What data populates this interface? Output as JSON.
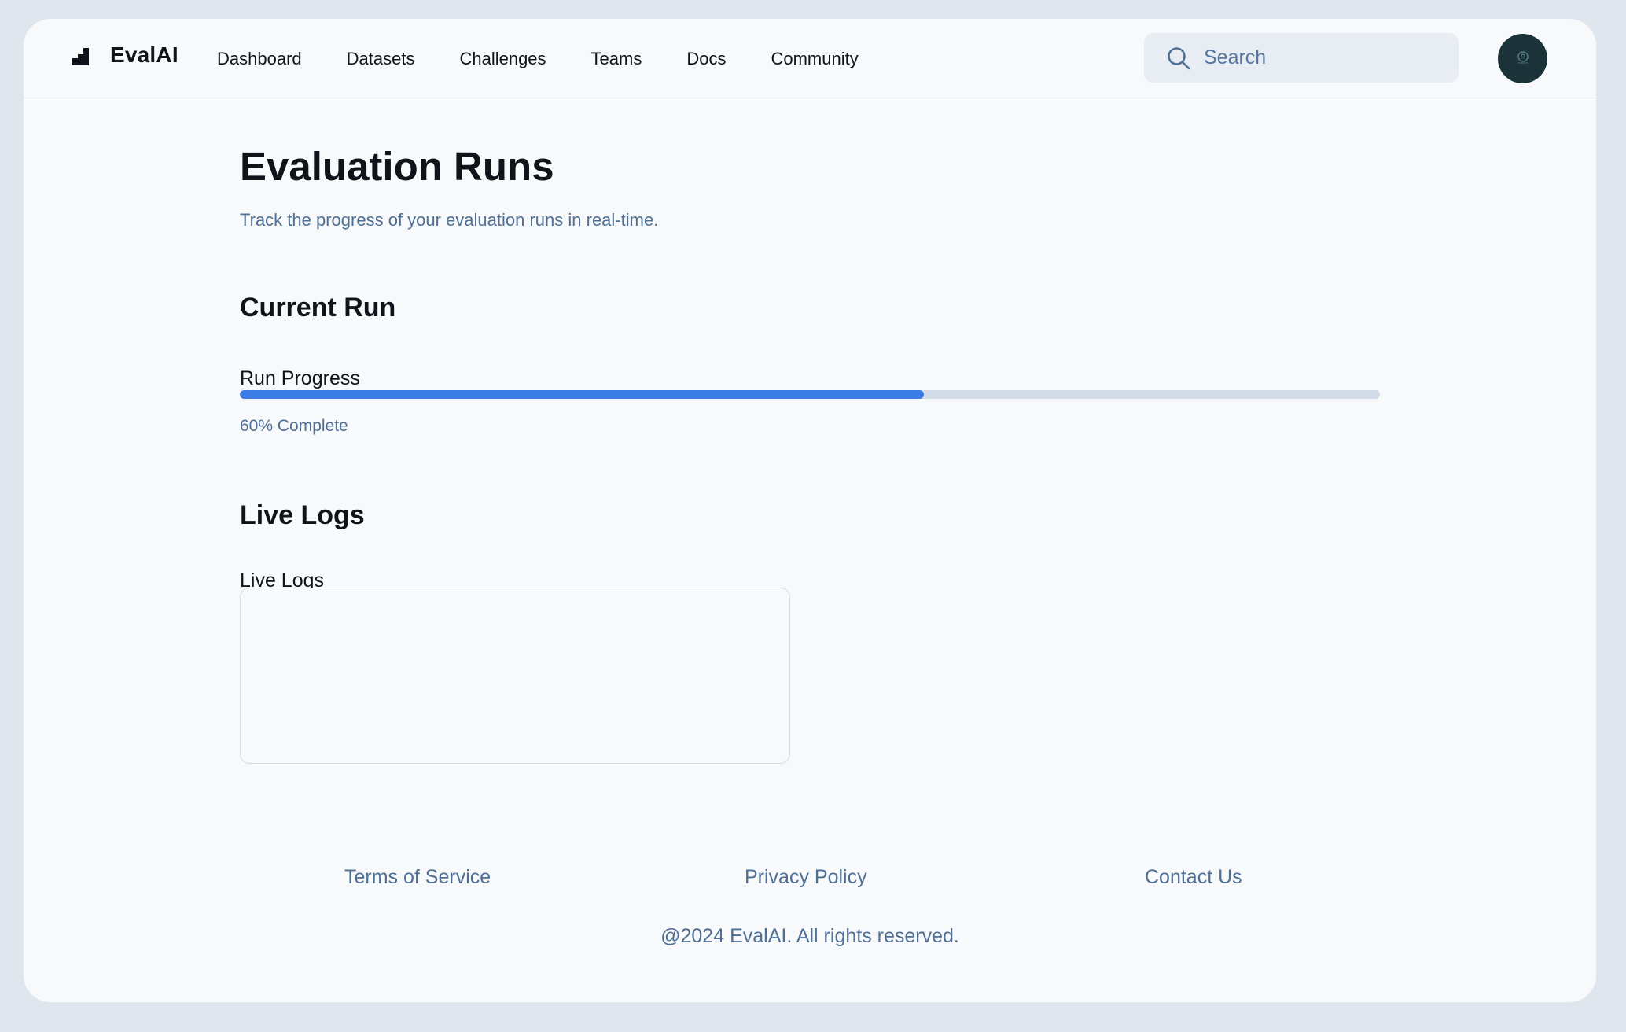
{
  "header": {
    "logo_text": "EvalAI",
    "nav": [
      "Dashboard",
      "Datasets",
      "Challenges",
      "Teams",
      "Docs",
      "Community"
    ],
    "search_placeholder": "Search"
  },
  "main": {
    "title": "Evaluation Runs",
    "subtitle": "Track the progress of your evaluation runs in real-time.",
    "current_run_heading": "Current Run",
    "progress_label": "Run Progress",
    "progress_percent": 60,
    "progress_text": "60% Complete",
    "live_logs_heading": "Live Logs",
    "live_logs_label": "Live Logs",
    "live_logs_value": ""
  },
  "footer": {
    "links": [
      "Terms of Service",
      "Privacy Policy",
      "Contact Us"
    ],
    "copyright": "@2024 EvalAI. All rights reserved."
  },
  "colors": {
    "accent": "#3b7de5",
    "muted_text": "#4f6f94",
    "track": "#d1dce8"
  },
  "icons": {
    "logo": "bar-chart-icon",
    "search": "search-icon",
    "avatar": "user-avatar"
  }
}
